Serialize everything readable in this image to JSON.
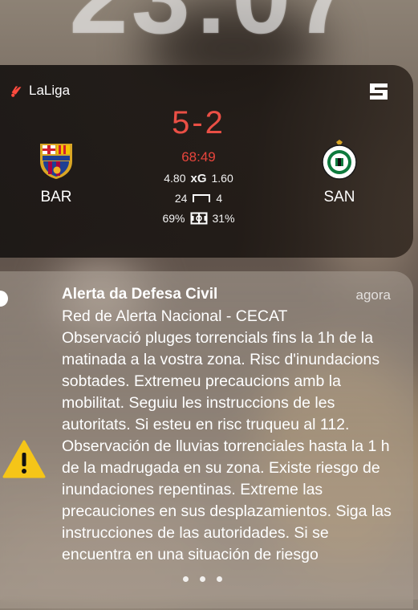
{
  "clock": {
    "time": "23:07"
  },
  "live_activity": {
    "league": "LaLiga",
    "home_team": {
      "abbr": "BAR",
      "crest_icon": "fc-barcelona-crest"
    },
    "away_team": {
      "abbr": "SAN",
      "crest_icon": "racing-santander-crest"
    },
    "score": "5-2",
    "minute": "68:49",
    "xg": {
      "home": "4.80",
      "label": "xG",
      "away": "1.60"
    },
    "shots": {
      "home": "24",
      "away": "4",
      "icon": "goal-icon"
    },
    "possession": {
      "home": "69%",
      "away": "31%",
      "icon": "pitch-icon"
    },
    "colors": {
      "score": "#ea4f45",
      "league_mark": "#ff4b3e"
    }
  },
  "notification": {
    "title": "Alerta da Defesa Civil",
    "time": "agora",
    "icon": "warning-icon",
    "body": "Red de Alerta Nacional - CECAT\nObservació pluges torrencials fins la 1h de la matinada a la vostra zona. Risc d'inundacions sobtades. Extremeu precaucions amb la mobilitat. Seguiu les instruccions de les autoritats. Si esteu en risc truqueu al 112.\nObservación de lluvias torrenciales hasta la 1 h de la madrugada en su zona. Existe riesgo de inundaciones repentinas. Extreme las precauciones en sus desplazamientos. Siga las instrucciones de las autoridades. Si se encuentra en una situación de riesgo"
  }
}
